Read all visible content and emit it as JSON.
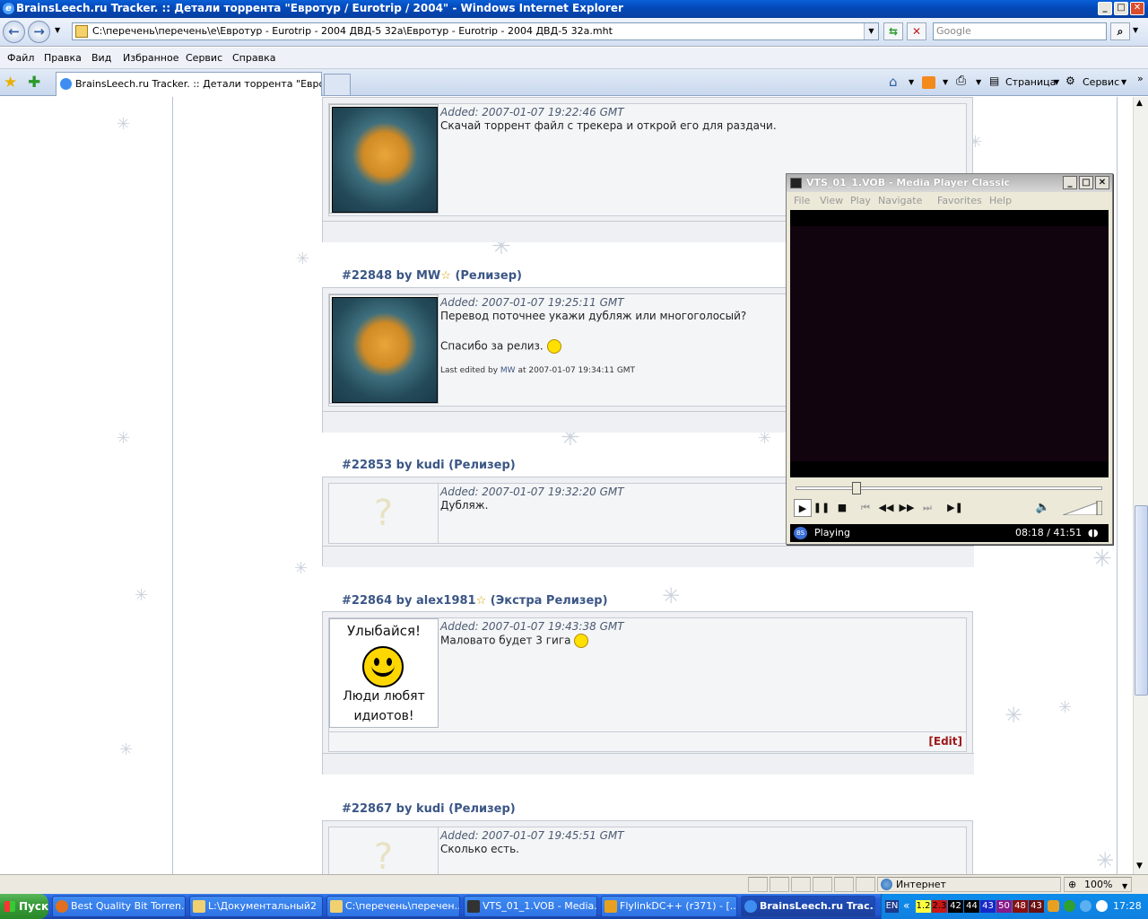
{
  "window": {
    "title": "BrainsLeech.ru Tracker. :: Детали торрента \"Евротур / Eurotrip / 2004\" - Windows Internet Explorer",
    "minimize": "_",
    "maximize": "□",
    "close": "✕"
  },
  "address": {
    "url": "C:\\перечень\\перечень\\е\\Евротур - Eurotrip - 2004 ДВД-5 32а\\Евротур - Eurotrip - 2004 ДВД-5 32а.mht",
    "search_placeholder": "Google"
  },
  "menu": [
    "Файл",
    "Правка",
    "Вид",
    "Избранное",
    "Сервис",
    "Справка"
  ],
  "tab": {
    "label": "BrainsLeech.ru Tracker. :: Детали торрента \"Еврот...",
    "page_label": "Страница",
    "tools_label": "Сервис"
  },
  "posts": [
    {
      "header": "",
      "added": "Added: 2007-01-07 19:22:46 GMT",
      "lines": [
        "Скачай торрент файл с трекера и открой его для раздачи."
      ]
    },
    {
      "number": "#22848",
      "by": "by",
      "user": "MW",
      "role": "(Релизер)",
      "added": "Added: 2007-01-07 19:25:11 GMT",
      "lines": [
        "Перевод поточнее укажи дубляж или многоголосый?",
        "Спасибо за релиз."
      ],
      "edited_prefix": "Last edited by",
      "edited_user": "MW",
      "edited_suffix": "at 2007-01-07 19:34:11 GMT"
    },
    {
      "number": "#22853",
      "by": "by",
      "user": "kudi",
      "role": "(Релизер)",
      "added": "Added: 2007-01-07 19:32:20 GMT",
      "lines": [
        "Дубляж."
      ],
      "avatar_placeholder": "?"
    },
    {
      "number": "#22864",
      "by": "by",
      "user": "alex1981",
      "role": "(Экстра Релизер)",
      "added": "Added: 2007-01-07 19:43:38 GMT",
      "lines": [
        "Маловато будет 3 гига"
      ],
      "avatar_top": "Улыбайся!",
      "avatar_bottom1": "Люди любят",
      "avatar_bottom2": "идиотов!",
      "edit_label": "[Edit]"
    },
    {
      "number": "#22867",
      "by": "by",
      "user": "kudi",
      "role": "(Релизер)",
      "added": "Added: 2007-01-07 19:45:51 GMT",
      "lines": [
        "Сколько есть."
      ],
      "avatar_placeholder": "?"
    }
  ],
  "status": {
    "zone": "Интернет",
    "zoom": "100%"
  },
  "mpc": {
    "title": "VTS_01_1.VOB - Media Player Classic",
    "menu": [
      "File",
      "View",
      "Play",
      "Navigate",
      "Favorites",
      "Help"
    ],
    "state": "Playing",
    "time": "08:18 / 41:51",
    "seek_fraction": 0.198,
    "badge": "BS"
  },
  "taskbar": {
    "start": "Пуск",
    "buttons": [
      "Best Quality Bit Torren...",
      "L:\\Документальный2",
      "C:\\перечень\\перечен...",
      "VTS_01_1.VOB - Media...",
      "FlylinkDC++ (r371) - [...",
      "BrainsLeech.ru Trac..."
    ],
    "lang": "EN",
    "tray_numbers": [
      "1.2",
      "2.3",
      "42",
      "44",
      "43",
      "50",
      "48",
      "43"
    ],
    "clock": "17:28"
  },
  "colors": {
    "link": "#3b5686",
    "edit": "#a01818",
    "titlebar": "#0a5fd8",
    "taskbar": "#245edb"
  }
}
